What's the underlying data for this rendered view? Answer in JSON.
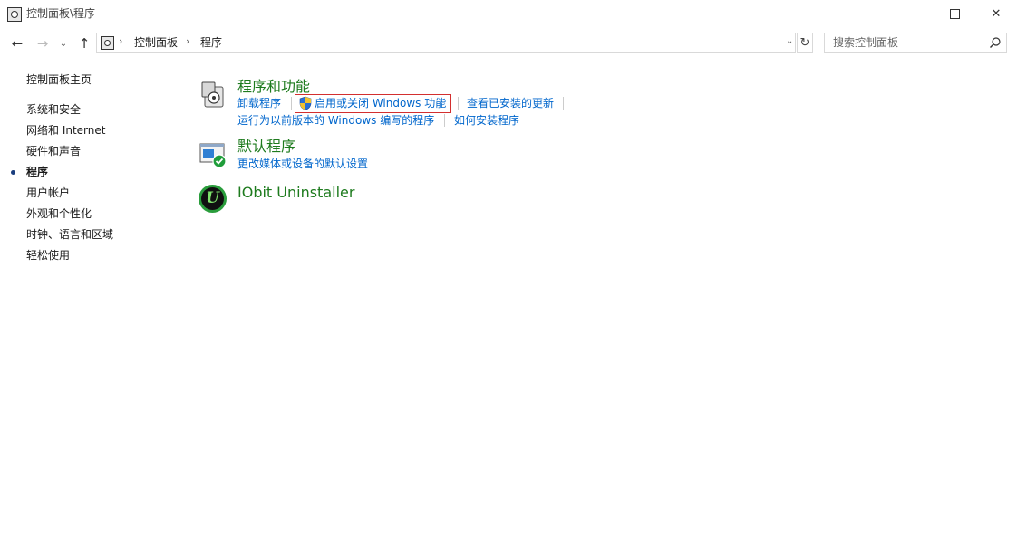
{
  "window": {
    "title": "控制面板\\程序",
    "minimize_icon": "minimize-icon",
    "maximize_icon": "maximize-icon",
    "close_glyph": "✕"
  },
  "nav": {
    "back_glyph": "←",
    "forward_glyph": "→",
    "recent_glyph": "⌄",
    "up_glyph": "↑",
    "refresh_glyph": "↻",
    "dropdown_glyph": "⌄"
  },
  "address": {
    "separator": "›",
    "crumbs": [
      "控制面板",
      "程序"
    ]
  },
  "search": {
    "placeholder": "搜索控制面板",
    "icon": "search-icon"
  },
  "sidebar": {
    "home": "控制面板主页",
    "items": [
      "系统和安全",
      "网络和 Internet",
      "硬件和声音",
      "程序",
      "用户帐户",
      "外观和个性化",
      "时钟、语言和区域",
      "轻松使用"
    ],
    "active_index": 3
  },
  "categories": {
    "programs": {
      "title": "程序和功能",
      "icon": "programs-features-icon",
      "links": [
        "卸载程序",
        "启用或关闭 Windows 功能",
        "查看已安装的更新",
        "运行为以前版本的 Windows 编写的程序",
        "如何安装程序"
      ]
    },
    "defaults": {
      "title": "默认程序",
      "icon": "default-programs-icon",
      "links": [
        "更改媒体或设备的默认设置"
      ]
    },
    "iobit": {
      "title": "IObit Uninstaller",
      "icon": "iobit-uninstaller-icon",
      "logo_letter": "U"
    }
  },
  "colors": {
    "category_title": "#1e7b1e",
    "link": "#0066cc",
    "highlight_border": "#d32f2f"
  }
}
